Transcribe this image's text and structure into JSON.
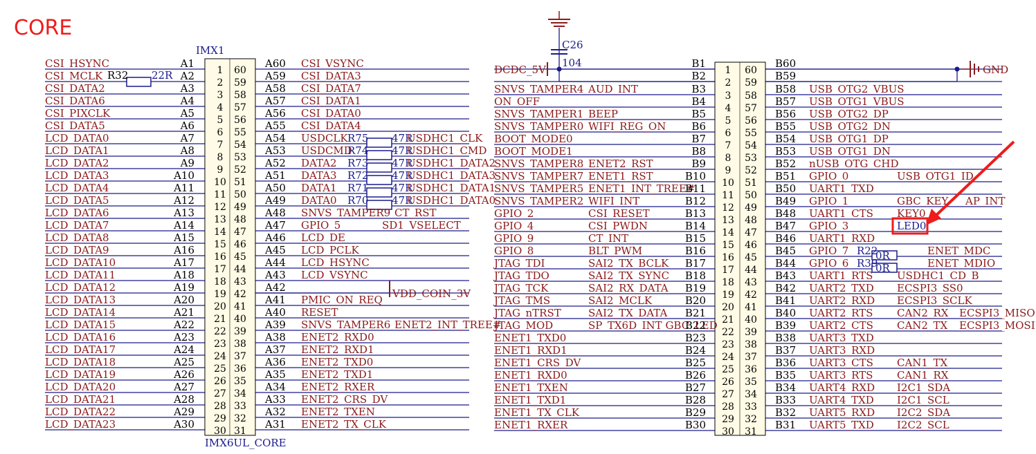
{
  "title": "CORE",
  "colors": {
    "net": "#8b1a1a",
    "wire": "#1a1a8c",
    "body": "#fffbe6",
    "highlight": "#ee1c1c"
  },
  "left": {
    "designator": "IMX1",
    "part": "IMX6UL_CORE",
    "rows": [
      {
        "ln": "CSI_HSYNC",
        "lp": "A1",
        "rp": "A60",
        "rn": "CSI_VSYNC"
      },
      {
        "ln": "CSI_MCLK",
        "lp": "A2",
        "rp": "A59",
        "rn": "CSI_DATA3"
      },
      {
        "ln": "CSI_DATA2",
        "lp": "A3",
        "rp": "A58",
        "rn": "CSI_DATA7"
      },
      {
        "ln": "CSI_DATA6",
        "lp": "A4",
        "rp": "A57",
        "rn": "CSI_DATA1"
      },
      {
        "ln": "CSI_PIXCLK",
        "lp": "A5",
        "rp": "A56",
        "rn": "CSI_DATA0"
      },
      {
        "ln": "CSI_DATA5",
        "lp": "A6",
        "rp": "A55",
        "rn": "CSI_DATA4"
      },
      {
        "ln": "LCD_DATA0",
        "lp": "A7",
        "rp": "A54",
        "rn": "USDCLK"
      },
      {
        "ln": "LCD_DATA1",
        "lp": "A8",
        "rp": "A53",
        "rn": "USDCMD"
      },
      {
        "ln": "LCD_DATA2",
        "lp": "A9",
        "rp": "A52",
        "rn": "DATA2"
      },
      {
        "ln": "LCD_DATA3",
        "lp": "A10",
        "rp": "A51",
        "rn": "DATA3"
      },
      {
        "ln": "LCD_DATA4",
        "lp": "A11",
        "rp": "A50",
        "rn": "DATA1"
      },
      {
        "ln": "LCD_DATA5",
        "lp": "A12",
        "rp": "A49",
        "rn": "DATA0"
      },
      {
        "ln": "LCD_DATA6",
        "lp": "A13",
        "rp": "A48",
        "rn": "SNVS_TAMPER9"
      },
      {
        "ln": "LCD_DATA7",
        "lp": "A14",
        "rp": "A47",
        "rn": "GPIO_5"
      },
      {
        "ln": "LCD_DATA8",
        "lp": "A15",
        "rp": "A46",
        "rn": "LCD_DE"
      },
      {
        "ln": "LCD_DATA9",
        "lp": "A16",
        "rp": "A45",
        "rn": "LCD_PCLK"
      },
      {
        "ln": "LCD_DATA10",
        "lp": "A17",
        "rp": "A44",
        "rn": "LCD_HSYNC"
      },
      {
        "ln": "LCD_DATA11",
        "lp": "A18",
        "rp": "A43",
        "rn": "LCD_VSYNC"
      },
      {
        "ln": "LCD_DATA12",
        "lp": "A19",
        "rp": "A42",
        "rn": ""
      },
      {
        "ln": "LCD_DATA13",
        "lp": "A20",
        "rp": "A41",
        "rn": "PMIC_ON_REQ"
      },
      {
        "ln": "LCD_DATA14",
        "lp": "A21",
        "rp": "A40",
        "rn": "RESET"
      },
      {
        "ln": "LCD_DATA15",
        "lp": "A22",
        "rp": "A39",
        "rn": "SNVS_TAMPER6"
      },
      {
        "ln": "LCD_DATA16",
        "lp": "A23",
        "rp": "A38",
        "rn": "ENET2_RXD0"
      },
      {
        "ln": "LCD_DATA17",
        "lp": "A24",
        "rp": "A37",
        "rn": "ENET2_RXD1"
      },
      {
        "ln": "LCD_DATA18",
        "lp": "A25",
        "rp": "A36",
        "rn": "ENET2_TXD0"
      },
      {
        "ln": "LCD_DATA19",
        "lp": "A26",
        "rp": "A35",
        "rn": "ENET2_TXD1"
      },
      {
        "ln": "LCD_DATA20",
        "lp": "A27",
        "rp": "A34",
        "rn": "ENET2_RXER"
      },
      {
        "ln": "LCD_DATA21",
        "lp": "A28",
        "rp": "A33",
        "rn": "ENET2_CRS_DV"
      },
      {
        "ln": "LCD_DATA22",
        "lp": "A29",
        "rp": "A32",
        "rn": "ENET2_TXEN"
      },
      {
        "ln": "LCD_DATA23",
        "lp": "A30",
        "rp": "A31",
        "rn": "ENET2_TX_CLK"
      }
    ],
    "extra": [
      {
        "row": 6,
        "res": "R75",
        "val": "47R",
        "net": "USDHC1_CLK"
      },
      {
        "row": 7,
        "res": "R74",
        "val": "47R",
        "net": "USDHC1_CMD"
      },
      {
        "row": 8,
        "res": "R73",
        "val": "47R",
        "net": "USDHC1_DATA2"
      },
      {
        "row": 9,
        "res": "R72",
        "val": "47R",
        "net": "USDHC1_DATA3"
      },
      {
        "row": 10,
        "res": "R71",
        "val": "47R",
        "net": "USDHC1_DATA1"
      },
      {
        "row": 11,
        "res": "R70",
        "val": "47R",
        "net": "USDHC1_DATA0"
      }
    ],
    "far": [
      {
        "row": 12,
        "net": "CT_RST"
      },
      {
        "row": 13,
        "net": "SD1_VSELECT"
      },
      {
        "row": 21,
        "net": "ENET2_INT_TREE#"
      }
    ],
    "r32": {
      "ref": "R32",
      "val": "22R"
    },
    "vdd": "VDD_COIN_3V"
  },
  "right": {
    "rows": [
      {
        "ln": "",
        "lp": "B1",
        "rp": "B60",
        "rn": ""
      },
      {
        "ln": "",
        "lp": "B2",
        "rp": "B59",
        "rn": ""
      },
      {
        "ln": "SNVS_TAMPER4",
        "ln2": "AUD_INT",
        "lp": "B3",
        "rp": "B58",
        "rn": "USB_OTG2_VBUS"
      },
      {
        "ln": "ON_OFF",
        "ln2": "",
        "lp": "B4",
        "rp": "B57",
        "rn": "USB_OTG1_VBUS"
      },
      {
        "ln": "SNVS_TAMPER1",
        "ln2": "BEEP",
        "lp": "B5",
        "rp": "B56",
        "rn": "USB_OTG2_DP"
      },
      {
        "ln": "SNVS_TAMPER0",
        "ln2": "WIFI_REG_ON",
        "lp": "B6",
        "rp": "B55",
        "rn": "USB_OTG2_DN"
      },
      {
        "ln": "BOOT_MODE0",
        "ln2": "",
        "lp": "B7",
        "rp": "B54",
        "rn": "USB_OTG1_DP"
      },
      {
        "ln": "BOOT_MODE1",
        "ln2": "",
        "lp": "B8",
        "rp": "B53",
        "rn": "USB_OTG1_DN"
      },
      {
        "ln": "SNVS_TAMPER8",
        "ln2": "ENET2_RST",
        "lp": "B9",
        "rp": "B52",
        "rn": "nUSB_OTG_CHD"
      },
      {
        "ln": "SNVS_TAMPER7",
        "ln2": "ENET1_RST",
        "lp": "B10",
        "rp": "B51",
        "rn": "GPIO_0"
      },
      {
        "ln": "SNVS_TAMPER5",
        "ln2": "ENET1_INT_TREE#",
        "lp": "B11",
        "rp": "B50",
        "rn": "UART1_TXD"
      },
      {
        "ln": "SNVS_TAMPER2",
        "ln2": "WIFI_INT",
        "lp": "B12",
        "rp": "B49",
        "rn": "GPIO_1"
      },
      {
        "ln": "GPIO_2",
        "ln2": "CSI_RESET",
        "lp": "B13",
        "rp": "B48",
        "rn": "UART1_CTS"
      },
      {
        "ln": "GPIO_4",
        "ln2": "CSI_PWDN",
        "lp": "B14",
        "rp": "B47",
        "rn": "GPIO_3"
      },
      {
        "ln": "GPIO_9",
        "ln2": "CT_INT",
        "lp": "B15",
        "rp": "B46",
        "rn": "UART1_RXD"
      },
      {
        "ln": "GPIO_8",
        "ln2": "BLT_PWM",
        "lp": "B16",
        "rp": "B45",
        "rn": "GPIO_7"
      },
      {
        "ln": "JTAG_TDI",
        "ln2": "SAI2_TX_BCLK",
        "lp": "B17",
        "rp": "B44",
        "rn": "GPIO_6"
      },
      {
        "ln": "JTAG_TDO",
        "ln2": "SAI2_TX_SYNC",
        "lp": "B18",
        "rp": "B43",
        "rn": "UART1_RTS"
      },
      {
        "ln": "JTAG_TCK",
        "ln2": "SAI2_RX_DATA",
        "lp": "B19",
        "rp": "B42",
        "rn": "UART2_TXD"
      },
      {
        "ln": "JTAG_TMS",
        "ln2": "SAI2_MCLK",
        "lp": "B20",
        "rp": "B41",
        "rn": "UART2_RXD"
      },
      {
        "ln": "JTAG_nTRST",
        "ln2": "SAI2_TX_DATA",
        "lp": "B21",
        "rp": "B40",
        "rn": "UART2_RTS"
      },
      {
        "ln": "JTAG_MOD",
        "ln2": "SP_TX6D_INT  GBC_LED",
        "lp": "B22",
        "rp": "B39",
        "rn": "UART2_CTS"
      },
      {
        "ln": "ENET1_TXD0",
        "ln2": "",
        "lp": "B23",
        "rp": "B38",
        "rn": "UART3_TXD"
      },
      {
        "ln": "ENET1_RXD1",
        "ln2": "",
        "lp": "B24",
        "rp": "B37",
        "rn": "UART3_RXD"
      },
      {
        "ln": "ENET1_CRS_DV",
        "ln2": "",
        "lp": "B25",
        "rp": "B36",
        "rn": "UART3_CTS"
      },
      {
        "ln": "ENET1_RXD0",
        "ln2": "",
        "lp": "B26",
        "rp": "B35",
        "rn": "UART3_RTS"
      },
      {
        "ln": "ENET1_TXEN",
        "ln2": "",
        "lp": "B27",
        "rp": "B34",
        "rn": "UART4_RXD"
      },
      {
        "ln": "ENET1_TXD1",
        "ln2": "",
        "lp": "B28",
        "rp": "B33",
        "rn": "UART4_TXD"
      },
      {
        "ln": "ENET1_TX_CLK",
        "ln2": "",
        "lp": "B29",
        "rp": "B32",
        "rn": "UART5_RXD"
      },
      {
        "ln": "ENET1_RXER",
        "ln2": "",
        "lp": "B30",
        "rp": "B31",
        "rn": "UART5_TXD"
      }
    ],
    "extra": [
      {
        "row": 9,
        "a": "USB_OTG1_ID",
        "b": ""
      },
      {
        "row": 11,
        "a": "GBC_KEY",
        "b": "AP_INT"
      },
      {
        "row": 12,
        "a": "KEY0",
        "b": ""
      },
      {
        "row": 13,
        "a": "LED0",
        "b": ""
      },
      {
        "row": 15,
        "a": "ENET_MDC",
        "b": ""
      },
      {
        "row": 16,
        "a": "ENET_MDIO",
        "b": ""
      },
      {
        "row": 17,
        "a": "USDHC1_CD_B",
        "b": ""
      },
      {
        "row": 18,
        "a": "ECSPI3_SS0",
        "b": ""
      },
      {
        "row": 19,
        "a": "ECSPI3_SCLK",
        "b": ""
      },
      {
        "row": 20,
        "a": "CAN2_RX",
        "b": "ECSPI3_MISO"
      },
      {
        "row": 21,
        "a": "CAN2_TX",
        "b": "ECSPI3_MOSI"
      },
      {
        "row": 24,
        "a": "CAN1_TX",
        "b": ""
      },
      {
        "row": 25,
        "a": "CAN1_RX",
        "b": ""
      },
      {
        "row": 26,
        "a": "I2C1_SDA",
        "b": ""
      },
      {
        "row": 27,
        "a": "I2C1_SCL",
        "b": ""
      },
      {
        "row": 28,
        "a": "I2C2_SDA",
        "b": ""
      },
      {
        "row": 29,
        "a": "I2C2_SCL",
        "b": ""
      }
    ],
    "r22": {
      "ref": "R22",
      "val": "0R"
    },
    "r39": {
      "ref": "R39",
      "val": "0R"
    },
    "c26": {
      "ref": "C26",
      "val": "104"
    },
    "dcdc": "DCDC_5V",
    "gnd": "GND"
  },
  "pin_nums_left": [
    "1",
    "2",
    "3",
    "4",
    "5",
    "6",
    "7",
    "8",
    "9",
    "10",
    "11",
    "12",
    "13",
    "14",
    "15",
    "16",
    "17",
    "18",
    "19",
    "20",
    "21",
    "22",
    "23",
    "24",
    "25",
    "26",
    "27",
    "28",
    "29",
    "30"
  ],
  "pin_nums_right": [
    "60",
    "59",
    "58",
    "57",
    "56",
    "55",
    "54",
    "53",
    "52",
    "51",
    "50",
    "49",
    "48",
    "47",
    "46",
    "45",
    "44",
    "43",
    "42",
    "41",
    "40",
    "39",
    "38",
    "37",
    "36",
    "35",
    "34",
    "33",
    "32",
    "31"
  ]
}
